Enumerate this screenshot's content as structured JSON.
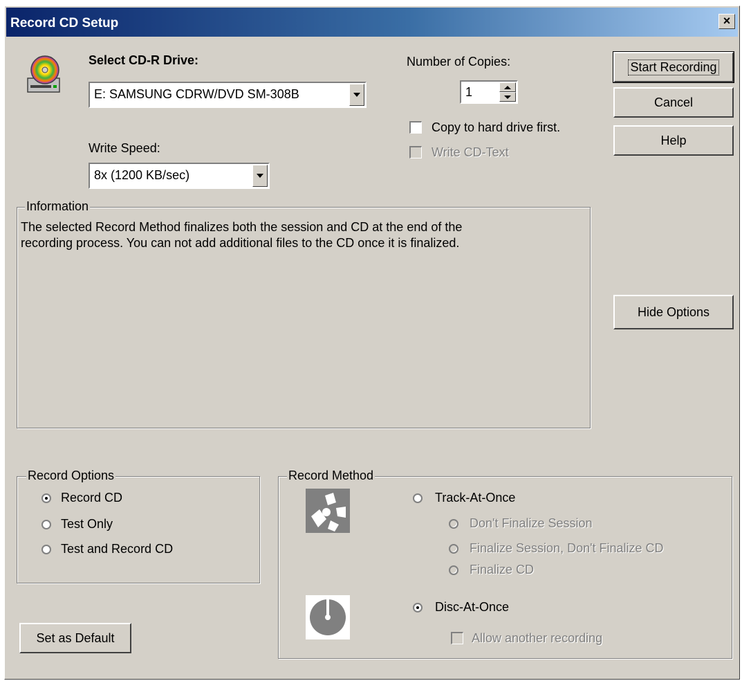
{
  "window": {
    "title": "Record CD Setup",
    "close_label": "×"
  },
  "drive": {
    "label": "Select CD-R Drive:",
    "selected": "E: SAMSUNG CDRW/DVD SM-308B"
  },
  "speed": {
    "label": "Write Speed:",
    "selected": "8x (1200 KB/sec)"
  },
  "copies": {
    "label": "Number of Copies:",
    "value": "1"
  },
  "options_checks": {
    "copy_to_hd": "Copy to hard drive first.",
    "write_cd_text": "Write CD-Text"
  },
  "buttons": {
    "start": "Start Recording",
    "cancel": "Cancel",
    "help": "Help",
    "hide_options": "Hide Options",
    "set_default": "Set as Default"
  },
  "information": {
    "legend": "Information",
    "line1": "The selected Record Method finalizes both the session and CD at the end of the",
    "line2": "recording process. You can not add additional files to the CD once it is finalized."
  },
  "record_options": {
    "legend": "Record Options",
    "items": [
      "Record CD",
      "Test Only",
      "Test and Record CD"
    ],
    "selected": "Record CD"
  },
  "record_method": {
    "legend": "Record Method",
    "track_at_once": "Track-At-Once",
    "tao_options": [
      "Don't Finalize Session",
      "Finalize Session, Don't Finalize CD",
      "Finalize CD"
    ],
    "disc_at_once": "Disc-At-Once",
    "allow_another": "Allow another recording",
    "selected": "Disc-At-Once"
  }
}
